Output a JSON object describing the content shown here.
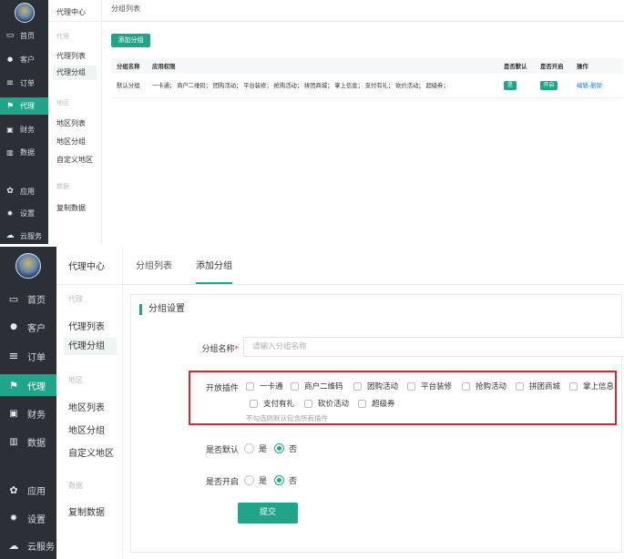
{
  "nav": {
    "items": [
      {
        "icon": "monitor-icon",
        "glyph": "▭",
        "label": "首页"
      },
      {
        "icon": "user-icon",
        "glyph": "●",
        "label": "客户"
      },
      {
        "icon": "list-icon",
        "glyph": "≡",
        "label": "订单"
      },
      {
        "icon": "flag-icon",
        "glyph": "⚑",
        "label": "代理"
      },
      {
        "icon": "money-icon",
        "glyph": "▣",
        "label": "财务"
      },
      {
        "icon": "chart-icon",
        "glyph": "▥",
        "label": "数据"
      },
      {
        "icon": "apps-icon",
        "glyph": "✿",
        "label": "应用"
      },
      {
        "icon": "gear-icon",
        "glyph": "✹",
        "label": "设置"
      },
      {
        "icon": "cloud-icon",
        "glyph": "☁",
        "label": "云服务"
      }
    ]
  },
  "sub": {
    "title": "代理中心",
    "sec_agent": "代理",
    "agent_list": "代理列表",
    "agent_group": "代理分组",
    "sec_region": "地区",
    "region_list": "地区列表",
    "region_group": "地区分组",
    "custom_region": "自定义地区",
    "sec_data": "数据",
    "copy_data": "复制数据"
  },
  "list_view": {
    "tab": "分组列表",
    "add_button": "添加分组",
    "headers": {
      "name": "分组名称",
      "perm": "应用权限",
      "default": "是否默认",
      "enabled": "是否开启",
      "ops": "操作"
    },
    "rows": [
      {
        "name": "默认分组",
        "perm": "一卡通； 商户二维码； 团购活动； 平台装修； 抢购活动； 拼团商城； 掌上信息； 支付有礼； 砍价活动； 超级券；",
        "default": "是",
        "enabled": "开启",
        "edit": "编辑",
        "sep": "-",
        "delete": "删除"
      }
    ]
  },
  "form_view": {
    "tabs": [
      "分组列表",
      "添加分组"
    ],
    "section_title": "分组设置",
    "name_label": "分组名称",
    "required_mark": "*",
    "name_placeholder": "请输入分组名称",
    "plugins_label": "开放插件",
    "plugins": [
      "一卡通",
      "商户二维码",
      "团购活动",
      "平台装修",
      "抢购活动",
      "拼团商城",
      "掌上信息",
      "支付有礼",
      "砍价活动",
      "超级券"
    ],
    "plugins_hint": "不勾选则默认包含所有插件",
    "default_label": "是否默认",
    "enabled_label": "是否开启",
    "yes": "是",
    "no": "否",
    "default_value": "否",
    "enabled_value": "否",
    "submit": "提交"
  },
  "colors": {
    "accent": "#20a48a",
    "sidebar": "#2b3036",
    "highlight_border": "#d9262b",
    "link": "#1e88c8"
  }
}
